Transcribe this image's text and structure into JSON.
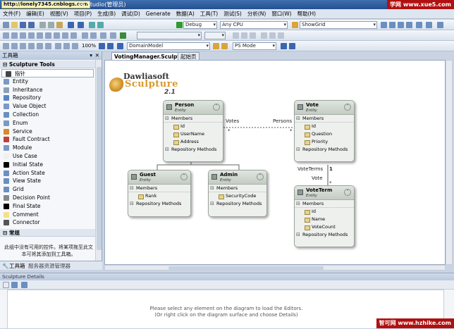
{
  "window": {
    "title": "ual Studio(管理员)",
    "url_badge": "http://lonely7345.cnblogs.com",
    "watermark_top": "学网 www.xue5.com",
    "watermark_bottom": "智可网 www.hzhike.com"
  },
  "menu": [
    "文件(F)",
    "编辑(E)",
    "视图(V)",
    "项目(P)",
    "生成(B)",
    "调试(D)",
    "Generate",
    "数据(A)",
    "工具(T)",
    "测试(S)",
    "分析(N)",
    "窗口(W)",
    "帮助(H)"
  ],
  "toolbar1": {
    "config": "Debug",
    "platform": "Any CPU",
    "find": "ShowGrid"
  },
  "toolbar3": {
    "zoom": "100%",
    "model": "DomainModel",
    "mode": "PS Mode"
  },
  "toolbox": {
    "title": "工具箱",
    "group1": "Sculpture Tools",
    "items": [
      {
        "label": "指针",
        "icon": "pointer-icon",
        "color": "#444"
      },
      {
        "label": "Entity",
        "icon": "entity-icon",
        "color": "#7a98c8"
      },
      {
        "label": "Inheritance",
        "icon": "inheritance-icon",
        "color": "#8aa0b8"
      },
      {
        "label": "Repository",
        "icon": "repository-icon",
        "color": "#5a86c5"
      },
      {
        "label": "Value Object",
        "icon": "value-object-icon",
        "color": "#7a98c8"
      },
      {
        "label": "Collection",
        "icon": "collection-icon",
        "color": "#6a8fc0"
      },
      {
        "label": "Enum",
        "icon": "enum-icon",
        "color": "#7a98c8"
      },
      {
        "label": "Service",
        "icon": "service-icon",
        "color": "#d68a2a"
      },
      {
        "label": "Fault Contract",
        "icon": "fault-contract-icon",
        "color": "#c04040"
      },
      {
        "label": "Module",
        "icon": "module-icon",
        "color": "#7a98c8"
      },
      {
        "label": "Use Case",
        "icon": "use-case-icon",
        "color": "#f0f0f0"
      },
      {
        "label": "Initial State",
        "icon": "initial-state-icon",
        "color": "#000"
      },
      {
        "label": "Action State",
        "icon": "action-state-icon",
        "color": "#6a8fc0"
      },
      {
        "label": "View State",
        "icon": "view-state-icon",
        "color": "#6a8fc0"
      },
      {
        "label": "Grid",
        "icon": "grid-icon",
        "color": "#6a8fc0"
      },
      {
        "label": "Decision Point",
        "icon": "decision-point-icon",
        "color": "#888"
      },
      {
        "label": "Final State",
        "icon": "final-state-icon",
        "color": "#000"
      },
      {
        "label": "Comment",
        "icon": "comment-icon",
        "color": "#f3e08a"
      },
      {
        "label": "Connector",
        "icon": "connector-icon",
        "color": "#555"
      }
    ],
    "group2": "常规",
    "empty_text": "此组中没有可用的控件。将某项拖至此文本可将其添加到工具箱。",
    "tabs": [
      "工具箱",
      "服务器资源管理器"
    ]
  },
  "doc_tabs": [
    "VotingManager.Sculpture*",
    "起始页"
  ],
  "logo": {
    "name": "Dawliasoft",
    "product": "Sculpture",
    "version": "2.1"
  },
  "entities": {
    "person": {
      "name": "Person",
      "type": "Entity",
      "members_label": "Members",
      "members": [
        "Id",
        "UserName",
        "Address"
      ],
      "methods_label": "Repository Methods"
    },
    "vote": {
      "name": "Vote",
      "type": "Entity",
      "members_label": "Members",
      "members": [
        "Id",
        "Question",
        "Priority"
      ],
      "methods_label": "Repository Methods"
    },
    "guest": {
      "name": "Guest",
      "type": "Entity",
      "members_label": "Members",
      "members": [
        "Rank"
      ],
      "methods_label": "Repository Methods"
    },
    "admin": {
      "name": "Admin",
      "type": "Entity",
      "members_label": "Members",
      "members": [
        "SecurityCode"
      ],
      "methods_label": "Repository Methods"
    },
    "voteterm": {
      "name": "VoteTerm",
      "type": "Entity",
      "members_label": "Members",
      "members": [
        "Id",
        "Name",
        "VoteCount"
      ],
      "methods_label": "Repository Methods"
    }
  },
  "relations": {
    "votes": "Votes",
    "persons": "Persons",
    "voteterms": "VoteTerms",
    "vote": "Vote",
    "one": "1",
    "star1": "*",
    "star2": "*",
    "star3": "*"
  },
  "details": {
    "title": "Sculpture Details",
    "message1": "Please select any element on the diagram to load the Editors.",
    "message2": "(Or right click on the diagram surface and choose Details)"
  }
}
